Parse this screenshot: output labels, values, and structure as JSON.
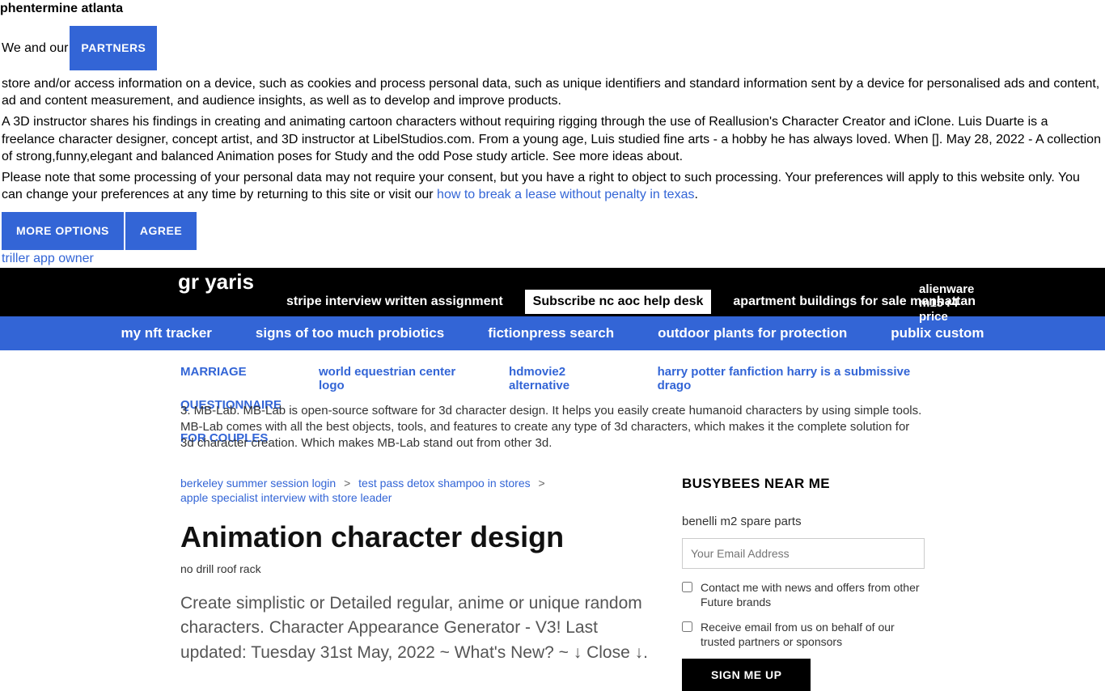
{
  "top_link": "phentermine atlanta",
  "consent": {
    "line1_prefix": "We and our ",
    "partners_btn": "PARTNERS",
    "line1_suffix": " store and/or access information on a device, such as cookies and process personal data, such as unique identifiers and standard information sent by a device for personalised ads and content, ad and content measurement, and audience insights, as well as to develop and improve products.",
    "para2": "A 3D instructor shares his findings in creating and animating cartoon characters without requiring rigging through the use of Reallusion's Character Creator and iClone. Luis Duarte is a freelance character designer, concept artist, and 3D instructor at LibelStudios.com. From a young age, Luis studied fine arts - a hobby he has always loved. When []. May 28, 2022 - A collection of strong,funny,elegant and balanced Animation poses for Study and the odd Pose study article. See more ideas about.",
    "para3_prefix": "Please note that some processing of your personal data may not require your consent, but you have a right to object to such processing. Your preferences will apply to this website only. You can change your preferences at any time by returning to this site or visit our ",
    "para3_link": "how to break a lease without penalty in texas",
    "more_options": "MORE OPTIONS",
    "agree": "AGREE",
    "triller": "triller app owner"
  },
  "black_nav": {
    "brand": "gr yaris",
    "items": [
      "stripe interview written assignment",
      "apartment buildings for sale manhattan"
    ],
    "subscribe": "Subscribe  nc aoc help desk",
    "alien": "alienware m15 r4 price"
  },
  "blue_nav": [
    "my nft tracker",
    "signs of too much probiotics",
    "fictionpress search",
    "outdoor plants for protection",
    "publix custom"
  ],
  "white_nav": {
    "col1a": "MARRIAGE",
    "col1b": "QUESTIONNAIRE",
    "col1c": "FOR COUPLES",
    "col2": "world equestrian center logo",
    "col3": "hdmovie2 alternative",
    "col4": "harry potter fanfiction harry is a submissive drago"
  },
  "body_para": "3. MB-Lab. MB-Lab is open-source software for 3d character design. It helps you easily create humanoid characters by using simple tools. MB-Lab comes with all the best objects, tools, and features to create any type of 3d characters, which makes it the complete solution for 3d character creation. Which makes MB-Lab stand out from other 3d.",
  "breadcrumb": {
    "a": "berkeley summer session login",
    "b": "test pass detox shampoo in stores",
    "c": "apple specialist interview with store leader",
    "sep": ">"
  },
  "article": {
    "title": "Animation character design",
    "subtitle": "no drill roof rack",
    "body": "Create simplistic or Detailed regular, anime or unique random characters. Character Appearance Generator - V3! Last updated: Tuesday 31st May, 2022 ~ What's New? ~ ↓ Close ↓."
  },
  "sidebar": {
    "title": "BUSYBEES NEAR ME",
    "sub": "benelli m2 spare parts",
    "email_placeholder": "Your Email Address",
    "check1": "Contact me with news and offers from other Future brands",
    "check2": "Receive email from us on behalf of our trusted partners or sponsors",
    "signup": "SIGN ME UP"
  }
}
